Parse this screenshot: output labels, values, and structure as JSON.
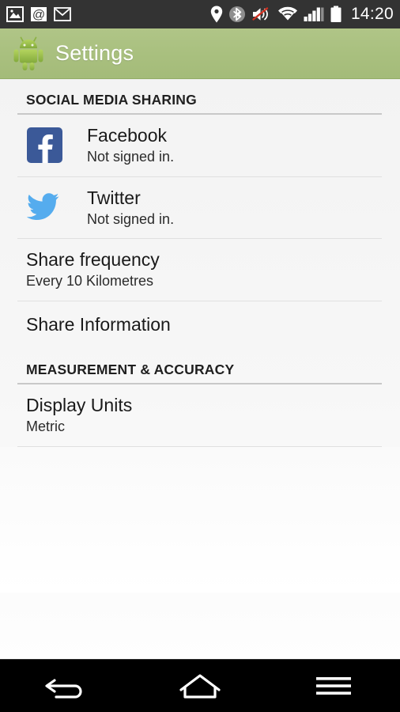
{
  "status_bar": {
    "left_icons": [
      {
        "name": "photo-icon",
        "label": "Photo"
      },
      {
        "name": "email-at-icon",
        "label": "Email"
      },
      {
        "name": "gmail-icon",
        "label": "Gmail"
      }
    ],
    "right_icons": [
      {
        "name": "location-pin-icon",
        "label": "Location"
      },
      {
        "name": "bluetooth-icon",
        "label": "Bluetooth"
      },
      {
        "name": "volume-muted-icon",
        "label": "Silent"
      },
      {
        "name": "wifi-icon",
        "label": "Wi-Fi"
      },
      {
        "name": "cellular-signal-icon",
        "label": "Signal"
      },
      {
        "name": "battery-icon",
        "label": "Battery"
      }
    ],
    "time": "14:20",
    "background_color": "#333333"
  },
  "action_bar": {
    "title": "Settings",
    "logo": "android-robot-icon",
    "background_color": "#a9c07f",
    "title_color": "#ffffff"
  },
  "sections": [
    {
      "header": "SOCIAL MEDIA SHARING",
      "rows": [
        {
          "icon": "facebook-icon",
          "icon_color": "#3b5998",
          "title": "Facebook",
          "subtitle": "Not signed in."
        },
        {
          "icon": "twitter-icon",
          "icon_color": "#55acee",
          "title": "Twitter",
          "subtitle": "Not signed in."
        },
        {
          "icon": null,
          "title": "Share frequency",
          "subtitle": "Every 10 Kilometres"
        },
        {
          "icon": null,
          "title": "Share Information",
          "subtitle": ""
        }
      ]
    },
    {
      "header": "MEASUREMENT & ACCURACY",
      "rows": [
        {
          "icon": null,
          "title": "Display Units",
          "subtitle": "Metric"
        }
      ]
    }
  ],
  "nav_bar": {
    "buttons": [
      {
        "name": "back-button",
        "label": "Back"
      },
      {
        "name": "home-button",
        "label": "Home"
      },
      {
        "name": "menu-button",
        "label": "Menu"
      }
    ],
    "background_color": "#000000"
  }
}
